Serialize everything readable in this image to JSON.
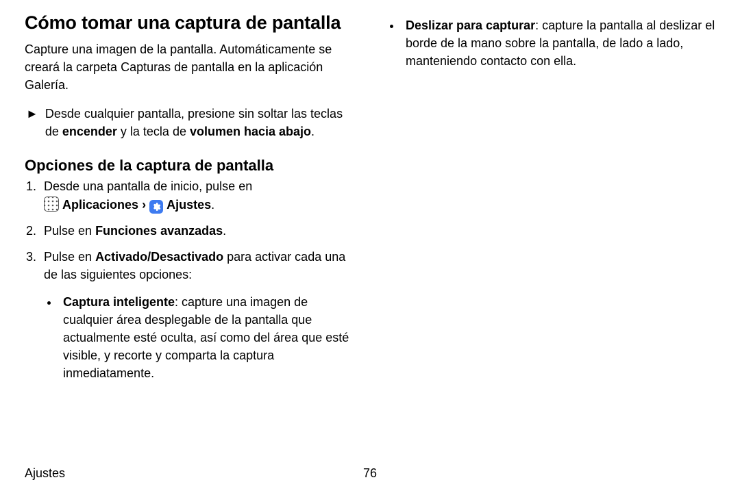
{
  "title": "Cómo tomar una captura de pantalla",
  "intro": "Capture una imagen de la pantalla. Automáticamente se creará la carpeta Capturas de pantalla en la aplicación Galería.",
  "instruction": {
    "prefix": "Desde cualquier pantalla, presione sin soltar las teclas de ",
    "bold1": "encender",
    "mid": " y la tecla de ",
    "bold2": "volumen hacia abajo",
    "suffix": "."
  },
  "subheading": "Opciones de la captura de pantalla",
  "step1": {
    "line": "Desde una pantalla de inicio, pulse en",
    "apps_label": "Aplicaciones",
    "settings_label": "Ajustes",
    "chevron": "›",
    "period": "."
  },
  "step2": {
    "prefix": "Pulse en ",
    "bold": "Funciones avanzadas",
    "suffix": "."
  },
  "step3": {
    "prefix": "Pulse en ",
    "bold": "Activado/Desactivado",
    "suffix": " para activar cada una de las siguientes opciones:"
  },
  "bullet1": {
    "bold": "Captura inteligente",
    "text": ": capture una imagen de cualquier área desplegable de la pantalla que actualmente esté oculta, así como del área que esté visible, y recorte y comparta la captura inmediatamente."
  },
  "bullet2": {
    "bold": "Deslizar para capturar",
    "text": ": capture la pantalla al deslizar el borde de la mano sobre la pantalla, de lado a lado, manteniendo contacto con ella."
  },
  "footer": {
    "section": "Ajustes",
    "page": "76"
  },
  "triangle": "►"
}
